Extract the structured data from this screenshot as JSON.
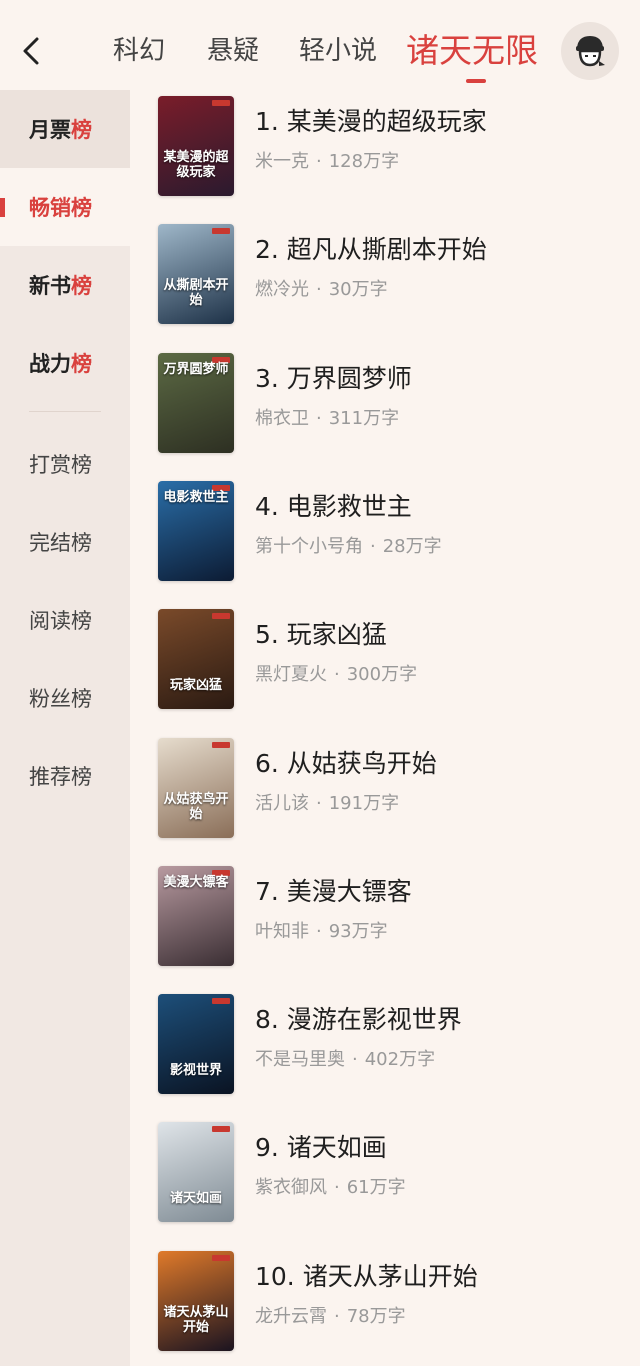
{
  "topbar": {
    "tabs": [
      {
        "label": "科幻",
        "active": false
      },
      {
        "label": "悬疑",
        "active": false
      },
      {
        "label": "轻小说",
        "active": false
      },
      {
        "label": "诸天无限",
        "active": true
      }
    ]
  },
  "sidebar": {
    "items": [
      {
        "label": "月票",
        "accent": "榜",
        "state": "highlight"
      },
      {
        "label": "畅销",
        "accent": "榜",
        "state": "selected"
      },
      {
        "label": "新书",
        "accent": "榜",
        "state": "highlight"
      },
      {
        "label": "战力",
        "accent": "榜",
        "state": "highlight"
      },
      {
        "label": "打赏榜",
        "accent": "",
        "state": "normal"
      },
      {
        "label": "完结榜",
        "accent": "",
        "state": "normal"
      },
      {
        "label": "阅读榜",
        "accent": "",
        "state": "normal"
      },
      {
        "label": "粉丝榜",
        "accent": "",
        "state": "normal"
      },
      {
        "label": "推荐榜",
        "accent": "",
        "state": "normal"
      }
    ]
  },
  "books": [
    {
      "title": "1. 某美漫的超级玩家",
      "author": "米一克",
      "words": "128万字",
      "cover_text": "某美漫的超级玩家",
      "cover_colors": [
        "#7a1d2a",
        "#2a1a2e"
      ]
    },
    {
      "title": "2. 超凡从撕剧本开始",
      "author": "燃冷光",
      "words": "30万字",
      "cover_text": "从撕剧本开始",
      "cover_colors": [
        "#9fb7c9",
        "#1e3248"
      ]
    },
    {
      "title": "3. 万界圆梦师",
      "author": "棉衣卫",
      "words": "311万字",
      "cover_text": "万界圆梦师",
      "cover_colors": [
        "#5c6a44",
        "#2d2f22"
      ]
    },
    {
      "title": "4. 电影救世主",
      "author": "第十个小号角",
      "words": "28万字",
      "cover_text": "电影救世主",
      "cover_colors": [
        "#2a6ea8",
        "#0c1b33"
      ]
    },
    {
      "title": "5. 玩家凶猛",
      "author": "黑灯夏火",
      "words": "300万字",
      "cover_text": "玩家凶猛",
      "cover_colors": [
        "#7a4a2a",
        "#2a1a12"
      ]
    },
    {
      "title": "6. 从姑获鸟开始",
      "author": "活儿该",
      "words": "191万字",
      "cover_text": "从姑获鸟开始",
      "cover_colors": [
        "#e6dccd",
        "#8a6e58"
      ]
    },
    {
      "title": "7. 美漫大镖客",
      "author": "叶知非",
      "words": "93万字",
      "cover_text": "美漫大镖客",
      "cover_colors": [
        "#b89aa0",
        "#3a2e33"
      ]
    },
    {
      "title": "8. 漫游在影视世界",
      "author": "不是马里奥",
      "words": "402万字",
      "cover_text": "影视世界",
      "cover_colors": [
        "#1d4f7a",
        "#0a1322"
      ]
    },
    {
      "title": "9. 诸天如画",
      "author": "紫衣御风",
      "words": "61万字",
      "cover_text": "诸天如画",
      "cover_colors": [
        "#dfe4e8",
        "#7f8b94"
      ]
    },
    {
      "title": "10. 诸天从茅山开始",
      "author": "龙升云霄",
      "words": "78万字",
      "cover_text": "诸天从茅山开始",
      "cover_colors": [
        "#e07a2a",
        "#1a1320"
      ]
    }
  ],
  "icons": {
    "back": "back-arrow-icon",
    "avatar": "user-avatar-icon"
  },
  "colors": {
    "accent": "#d9413e",
    "background": "#fbf4ef",
    "sidebar": "#f1e8e3"
  }
}
